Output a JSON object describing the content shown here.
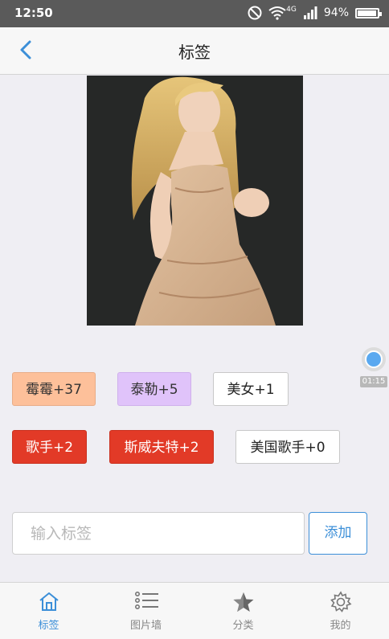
{
  "status_bar": {
    "time": "12:50",
    "network": "4G",
    "battery": "94%",
    "battery_level": 0.94
  },
  "nav": {
    "title": "标签",
    "back_icon": "chevron-left-icon"
  },
  "photo": {
    "subject": "portrait photo"
  },
  "floating_widget": {
    "timer": "01:15"
  },
  "tags": [
    {
      "label": "霉霉+37",
      "bg": "#fdc09a",
      "fg": "#333333",
      "border": "#e8ad88"
    },
    {
      "label": "泰勒+5",
      "bg": "#e0c3fa",
      "fg": "#333333",
      "border": "#cfb0ec"
    },
    {
      "label": "美女+1",
      "bg": "#ffffff",
      "fg": "#222222",
      "border": "#c8c8c8"
    },
    {
      "label": "歌手+2",
      "bg": "#e23a27",
      "fg": "#ffffff",
      "border": "#c9311f"
    },
    {
      "label": "斯威夫特+2",
      "bg": "#e23a27",
      "fg": "#ffffff",
      "border": "#c9311f"
    },
    {
      "label": "美国歌手+0",
      "bg": "#ffffff",
      "fg": "#222222",
      "border": "#c8c8c8"
    }
  ],
  "tag_input": {
    "placeholder": "输入标签",
    "value": ""
  },
  "add_button": {
    "label": "添加"
  },
  "tabbar": {
    "items": [
      {
        "label": "标签",
        "icon": "home-icon",
        "active": true
      },
      {
        "label": "图片墙",
        "icon": "list-icon",
        "active": false
      },
      {
        "label": "分类",
        "icon": "star-icon",
        "active": false
      },
      {
        "label": "我的",
        "icon": "gear-icon",
        "active": false
      }
    ]
  },
  "colors": {
    "accent": "#3c8fd8",
    "background": "#efeef3",
    "status_bar": "#5a5a5a"
  }
}
